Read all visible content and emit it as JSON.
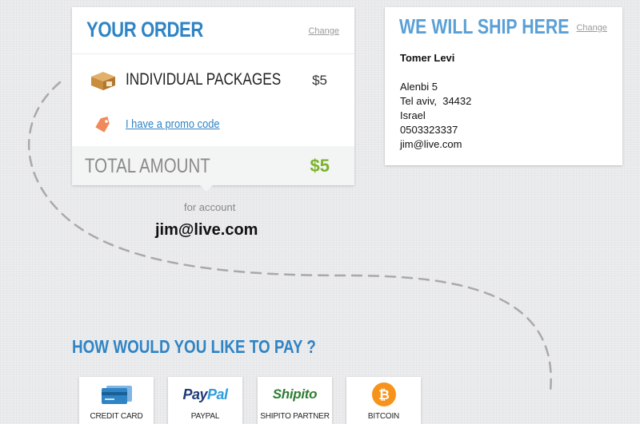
{
  "order": {
    "title": "YOUR ORDER",
    "change_link": "Change",
    "item": {
      "label": "INDIVIDUAL PACKAGES",
      "price": "$5"
    },
    "promo_link": "I have a promo code",
    "total_label": "TOTAL AMOUNT",
    "total_value": "$5"
  },
  "account": {
    "caption": "for account",
    "email": "jim@live.com"
  },
  "shipping": {
    "title": "WE WILL SHIP HERE",
    "change_link": "Change",
    "name": "Tomer Levi",
    "address_lines": [
      "Alenbi 5",
      "Tel aviv,  34432",
      "Israel",
      "0503323337",
      "jim@live.com"
    ]
  },
  "payment": {
    "title": "HOW WOULD YOU LIKE TO PAY ?",
    "options": [
      {
        "label": "CREDIT CARD",
        "icon": "credit-card-icon"
      },
      {
        "label": "PAYPAL",
        "logo_part1": "Pay",
        "logo_part2": "Pal"
      },
      {
        "label": "SHIPITO PARTNER",
        "logo": "Shipito"
      },
      {
        "label": "BITCOIN",
        "icon": "bitcoin-icon",
        "glyph": "₿"
      }
    ]
  },
  "colors": {
    "accent": "#2f84c5",
    "price_green": "#7cb32b",
    "background": "#e9eaec"
  }
}
